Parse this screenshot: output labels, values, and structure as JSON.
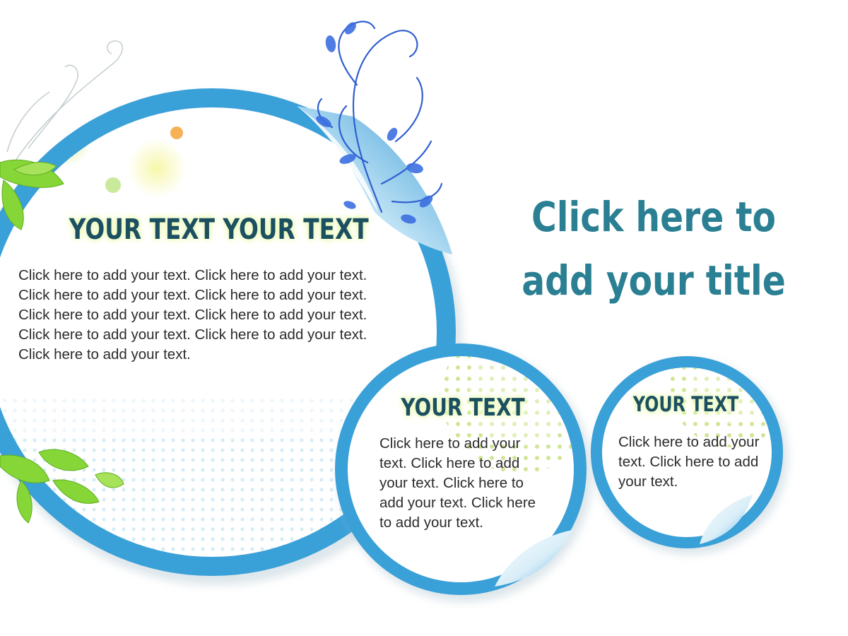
{
  "title": "Click here to add your title",
  "panels": {
    "large": {
      "heading": "YOUR TEXT YOUR TEXT",
      "body": "Click here to add your text. Click here to add your text. Click here to add your text. Click here to add your text. Click here to add your text. Click here to add your text. Click here to add your text. Click here to add your text. Click here to add your text."
    },
    "medium": {
      "heading": "YOUR TEXT",
      "body": "Click here to add your text. Click here to add your text. Click here to add your text. Click here to add your text."
    },
    "small": {
      "heading": "YOUR TEXT",
      "body": "Click here to add your text. Click here to add your text."
    }
  },
  "colors": {
    "ring_blue": "#3aa0d8",
    "title_teal": "#2a7f92",
    "heading_dark": "#1c4f61",
    "leaf_green": "#7ccf2a",
    "flourish_blue": "#2f5fd0"
  }
}
